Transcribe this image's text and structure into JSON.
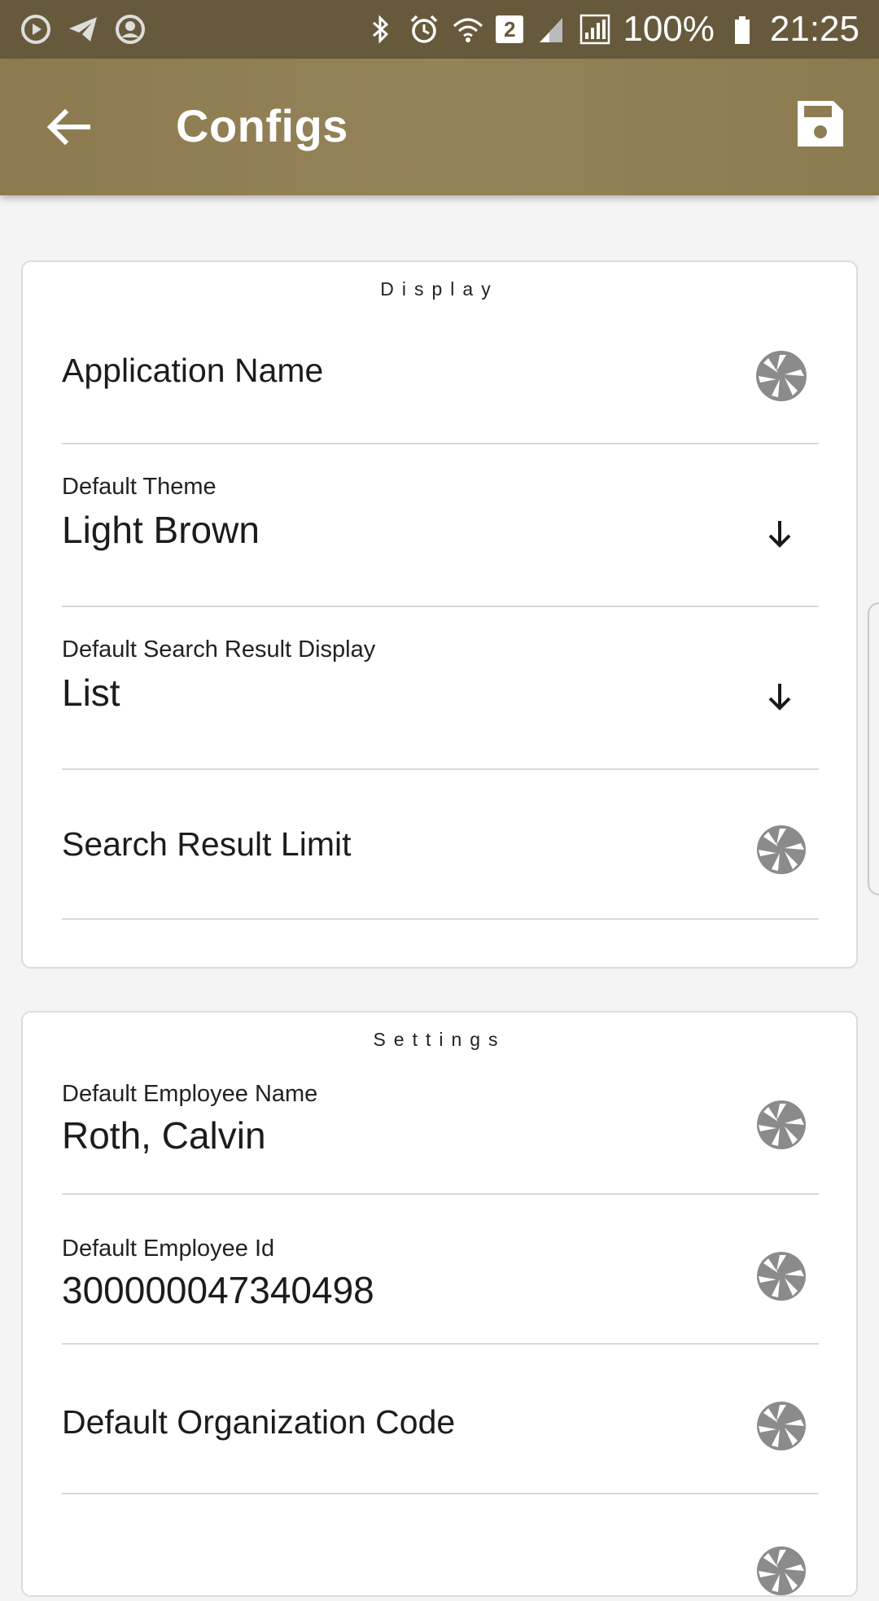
{
  "status_bar": {
    "battery": "100%",
    "time": "21:25",
    "notification_count": "2",
    "icons": [
      "play-circle-icon",
      "telegram-icon",
      "account-circle-icon",
      "bluetooth-icon",
      "alarm-icon",
      "wifi-icon",
      "signal-icon",
      "battery-icon"
    ]
  },
  "app_bar": {
    "title": "Configs",
    "back_icon": "arrow-left-icon",
    "save_icon": "floppy-disk-icon",
    "color": "#8f7c53"
  },
  "display_section": {
    "header": "Display",
    "rows": [
      {
        "title": "Application Name",
        "icon": "aperture-icon"
      },
      {
        "label": "Default Theme",
        "value": "Light Brown",
        "icon": "arrow-down-icon"
      },
      {
        "label": "Default Search Result Display",
        "value": "List",
        "icon": "arrow-down-icon"
      },
      {
        "title": "Search Result Limit",
        "icon": "aperture-icon"
      }
    ]
  },
  "settings_section": {
    "header": "Settings",
    "rows": [
      {
        "label": "Default Employee Name",
        "value": "Roth, Calvin",
        "icon": "aperture-icon"
      },
      {
        "label": "Default Employee Id",
        "value": "300000047340498",
        "icon": "aperture-icon"
      },
      {
        "title": "Default Organization Code",
        "icon": "aperture-icon"
      }
    ]
  }
}
